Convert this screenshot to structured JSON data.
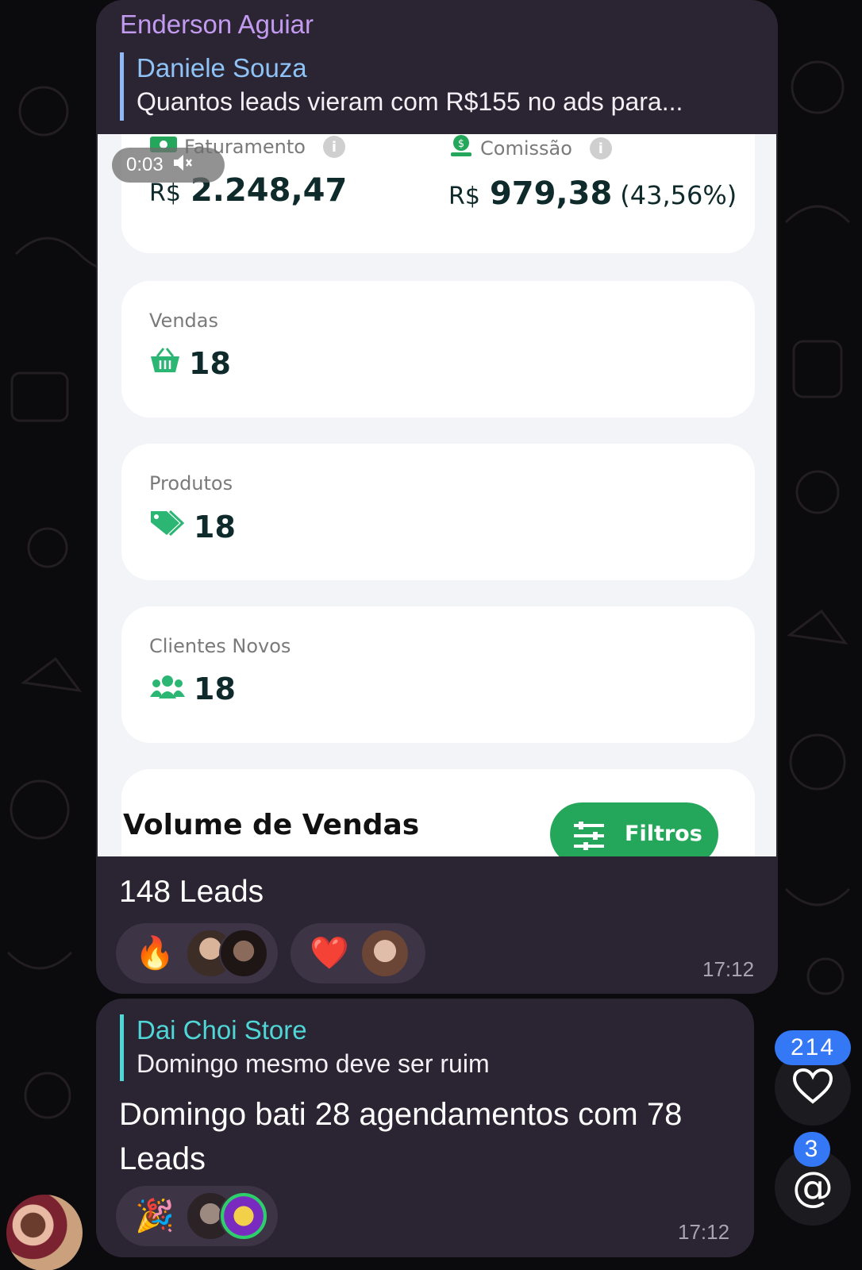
{
  "message1": {
    "sender": "Enderson Aguiar",
    "reply": {
      "name": "Daniele Souza",
      "text": "Quantos leads vieram com R$155 no ads para..."
    },
    "video": {
      "timer": "0:03",
      "faturamento": {
        "label": "Faturamento",
        "currency": "R$",
        "value": "2.248,47"
      },
      "comissao": {
        "label": "Comissão",
        "currency": "R$",
        "value": "979,38",
        "percent": "(43,56%)"
      },
      "cards": [
        {
          "label": "Vendas",
          "value": "18",
          "icon": "basket-icon"
        },
        {
          "label": "Produtos",
          "value": "18",
          "icon": "tag-icon"
        },
        {
          "label": "Clientes Novos",
          "value": "18",
          "icon": "users-icon"
        }
      ],
      "section_title": "Volume de Vendas",
      "filter_button": "Filtros"
    },
    "caption": "148 Leads",
    "reactions": [
      {
        "emoji": "🔥",
        "icon": "fire-icon"
      },
      {
        "emoji": "❤️",
        "icon": "heart-icon"
      }
    ],
    "time": "17:12"
  },
  "message2": {
    "reply": {
      "name": "Dai Choi Store",
      "text": "Domingo mesmo deve ser ruim"
    },
    "body": "Domingo bati 28 agendamentos com 78 Leads",
    "reactions": [
      {
        "emoji": "🎉",
        "icon": "party-popper-icon"
      }
    ],
    "time": "17:12"
  },
  "floating": {
    "reactions_badge": "214",
    "mentions_badge": "3"
  },
  "colors": {
    "bubble": "#2b2432",
    "sender": "#c29bf0",
    "reply_blue": "#8fc3f7",
    "reply_teal": "#4fd6d6",
    "accent_green": "#24a75a",
    "badge_blue": "#3478f6"
  }
}
